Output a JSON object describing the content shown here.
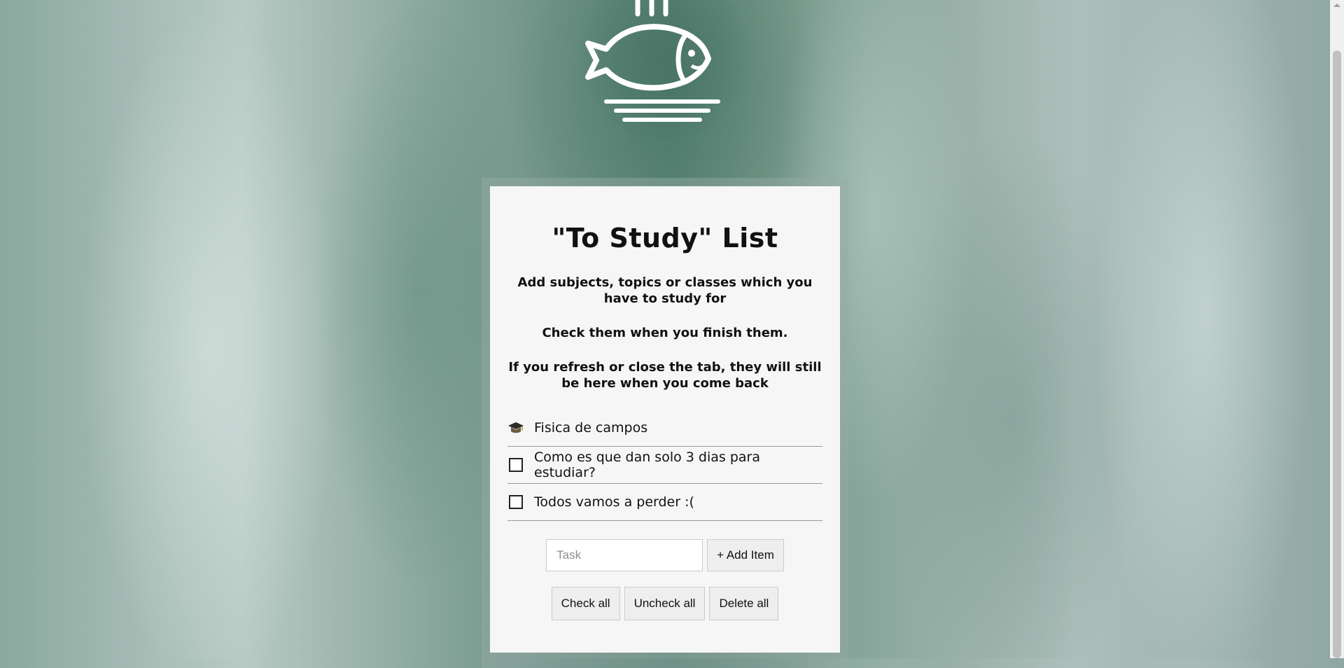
{
  "logo": {
    "icon": "fish-plate-icon"
  },
  "card": {
    "title": "\"To Study\" List",
    "description": [
      "Add subjects, topics or classes which you have to study for",
      "Check them when you finish them.",
      "If you refresh or close the tab, they will still be here when you come back"
    ],
    "items": [
      {
        "label": "Fisica de campos",
        "checked": true,
        "icon": "graduation-cap-icon"
      },
      {
        "label": "Como es que dan solo 3 dias para estudiar?",
        "checked": false
      },
      {
        "label": "Todos vamos a perder :(",
        "checked": false
      }
    ],
    "task_input": {
      "placeholder": "Task",
      "value": ""
    },
    "add_label": "+ Add Item",
    "check_all_label": "Check all",
    "uncheck_all_label": "Uncheck all",
    "delete_all_label": "Delete all"
  }
}
